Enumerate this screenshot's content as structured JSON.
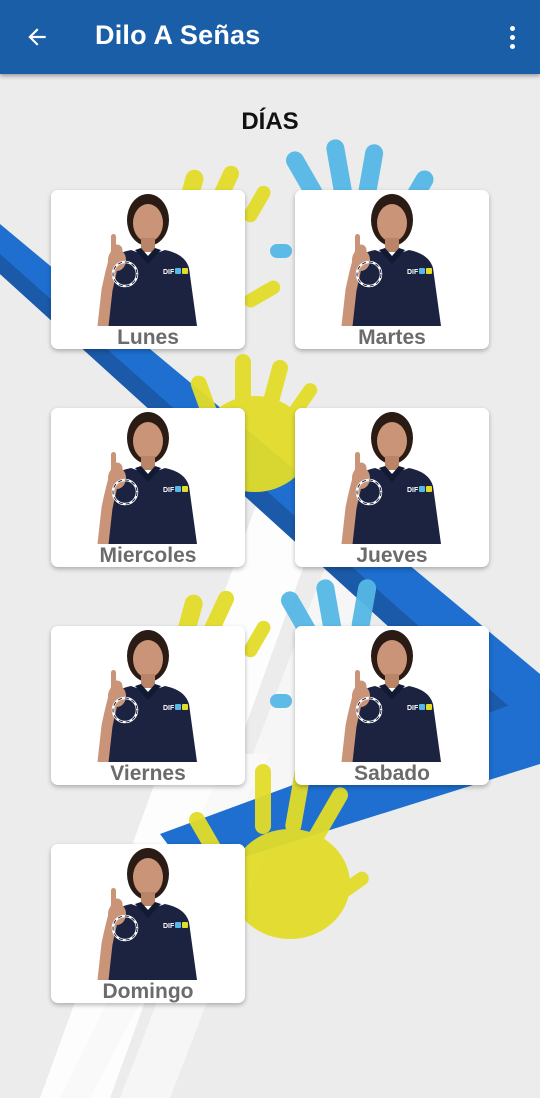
{
  "app_bar": {
    "title": "Dilo A Señas",
    "background": "#1a5ea8",
    "back_icon": "arrow-left-icon",
    "menu_icon": "more-vertical-icon"
  },
  "heading": "DÍAS",
  "colors": {
    "background": "#ececec",
    "blue_stripe": "#1e6fcf",
    "yellow_hand": "#e3dd2a",
    "light_blue_hand": "#56b8e6",
    "label": "#6b6b6b",
    "shirt": "#1c2340"
  },
  "days": [
    {
      "label": "Lunes",
      "sign": "L-hand"
    },
    {
      "label": "Martes",
      "sign": "M-hand"
    },
    {
      "label": "Miercoles",
      "sign": "M-hand"
    },
    {
      "label": "Jueves",
      "sign": "J-hand"
    },
    {
      "label": "Viernes",
      "sign": "V-hand"
    },
    {
      "label": "Sabado",
      "sign": "S-hand"
    },
    {
      "label": "Domingo",
      "sign": "D-hand"
    }
  ]
}
